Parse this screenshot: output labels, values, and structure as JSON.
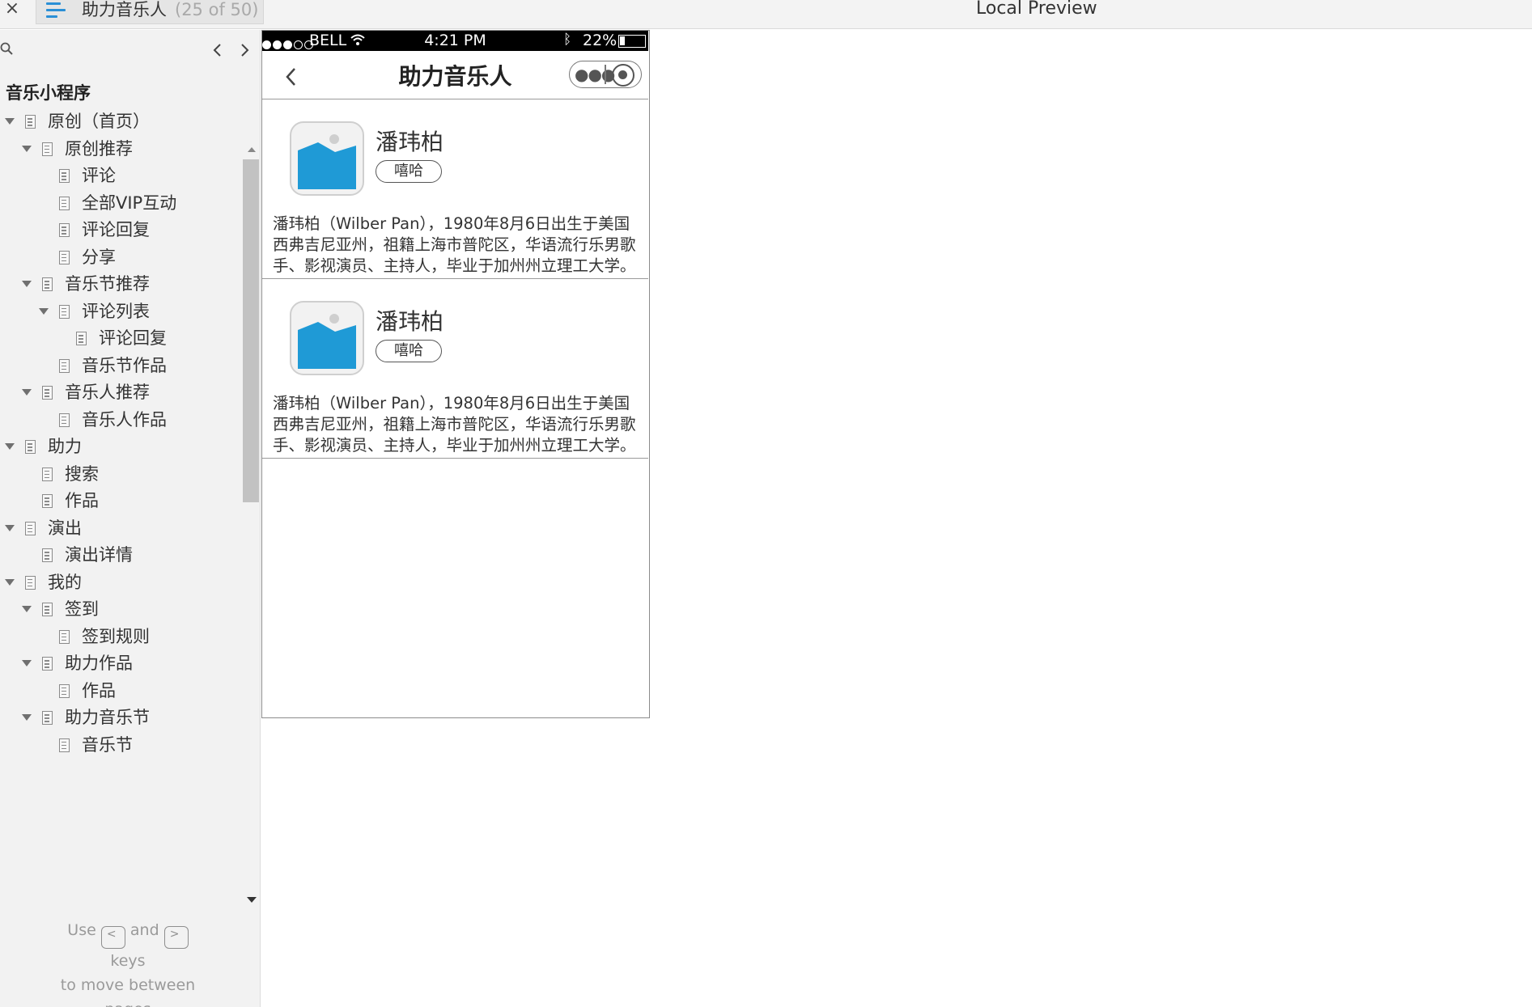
{
  "app": {
    "close_label": "×",
    "tab_title": "助力音乐人",
    "tab_count": "(25 of 50)",
    "preview_title": "Local Preview"
  },
  "sidebar": {
    "project_title": "音乐小程序",
    "tree": [
      {
        "label": "原创（首页）",
        "level": 0,
        "expanded": true
      },
      {
        "label": "原创推荐",
        "level": 1,
        "expanded": true
      },
      {
        "label": "评论",
        "level": 2,
        "expanded": false
      },
      {
        "label": "全部VIP互动",
        "level": 2,
        "expanded": false
      },
      {
        "label": "评论回复",
        "level": 2,
        "expanded": false
      },
      {
        "label": "分享",
        "level": 2,
        "expanded": false
      },
      {
        "label": "音乐节推荐",
        "level": 1,
        "expanded": true
      },
      {
        "label": "评论列表",
        "level": 2,
        "expanded": true
      },
      {
        "label": "评论回复",
        "level": 3,
        "expanded": false
      },
      {
        "label": "音乐节作品",
        "level": 2,
        "expanded": false
      },
      {
        "label": "音乐人推荐",
        "level": 1,
        "expanded": true
      },
      {
        "label": "音乐人作品",
        "level": 2,
        "expanded": false
      },
      {
        "label": "助力",
        "level": 0,
        "expanded": true
      },
      {
        "label": "搜索",
        "level": 1,
        "expanded": false
      },
      {
        "label": "作品",
        "level": 1,
        "expanded": false
      },
      {
        "label": "演出",
        "level": 0,
        "expanded": true
      },
      {
        "label": "演出详情",
        "level": 1,
        "expanded": false
      },
      {
        "label": "我的",
        "level": 0,
        "expanded": true
      },
      {
        "label": "签到",
        "level": 1,
        "expanded": true
      },
      {
        "label": "签到规则",
        "level": 2,
        "expanded": false
      },
      {
        "label": "助力作品",
        "level": 1,
        "expanded": true
      },
      {
        "label": "作品",
        "level": 2,
        "expanded": false
      },
      {
        "label": "助力音乐节",
        "level": 1,
        "expanded": true
      },
      {
        "label": "音乐节",
        "level": 2,
        "expanded": false
      }
    ],
    "hint": {
      "use": "Use",
      "prev_key": "<",
      "and": "and",
      "next_key": ">",
      "keys": "keys",
      "line2": "to move between",
      "line3": "pages"
    }
  },
  "phone": {
    "status": {
      "carrier": "BELL",
      "time": "4:21 PM",
      "battery": "22%"
    },
    "nav_title": "助力音乐人",
    "cards": [
      {
        "name": "潘玮柏",
        "tag": "嘻哈",
        "description": "潘玮柏（Wilber Pan），1980年8月6日出生于美国西弗吉尼亚州，祖籍上海市普陀区，华语流行乐男歌手、影视演员、主持人，毕业于加州州立理工大学。"
      },
      {
        "name": "潘玮柏",
        "tag": "嘻哈",
        "description": "潘玮柏（Wilber Pan），1980年8月6日出生于美国西弗吉尼亚州，祖籍上海市普陀区，华语流行乐男歌手、影视演员、主持人，毕业于加州州立理工大学。"
      }
    ]
  },
  "colors": {
    "accent": "#2a8fd6",
    "image_placeholder": "#1f9ad6"
  }
}
